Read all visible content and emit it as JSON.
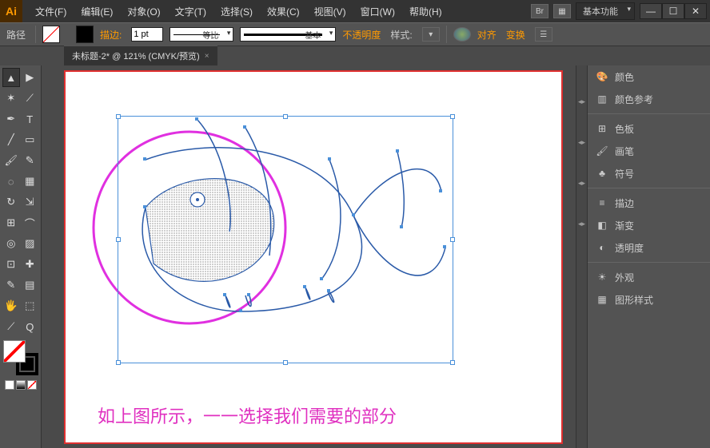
{
  "app_logo": "Ai",
  "menu": [
    "文件(F)",
    "编辑(E)",
    "对象(O)",
    "文字(T)",
    "选择(S)",
    "效果(C)",
    "视图(V)",
    "窗口(W)",
    "帮助(H)"
  ],
  "title_right": {
    "br": "Br",
    "workspace": "基本功能"
  },
  "window": {
    "min": "—",
    "max": "☐",
    "close": "✕"
  },
  "options": {
    "context": "路径",
    "stroke_label": "描边:",
    "stroke_value": "1 pt",
    "profile_label": "等比",
    "brush_label": "基本",
    "opacity_label": "不透明度",
    "style_label": "样式:",
    "align": "对齐",
    "transform": "变换"
  },
  "tab": {
    "name": "未标题-2* @ 121% (CMYK/预览)",
    "close": "×"
  },
  "panels": [
    "颜色",
    "颜色参考",
    "色板",
    "画笔",
    "符号",
    "描边",
    "渐变",
    "透明度",
    "外观",
    "图形样式"
  ],
  "panel_icons": [
    "🎨",
    "▥",
    "⊞",
    "🖌",
    "♣",
    "≡",
    "◧",
    "◐",
    "☀",
    "▦"
  ],
  "caption": "如上图所示，一一选择我们需要的部分",
  "tools": [
    [
      "▲",
      "▶"
    ],
    [
      "✶",
      "⟋"
    ],
    [
      "✒",
      "T"
    ],
    [
      "╱",
      "▭"
    ],
    [
      "🖌",
      "✎"
    ],
    [
      "◌",
      "▦"
    ],
    [
      "↻",
      "⇲"
    ],
    [
      "⊞",
      "⌒"
    ],
    [
      "◎",
      "▨"
    ],
    [
      "⊡",
      "✚"
    ],
    [
      "✎",
      "▤"
    ],
    [
      "🖐",
      "⬚"
    ],
    [
      "⟋",
      "Q"
    ]
  ]
}
